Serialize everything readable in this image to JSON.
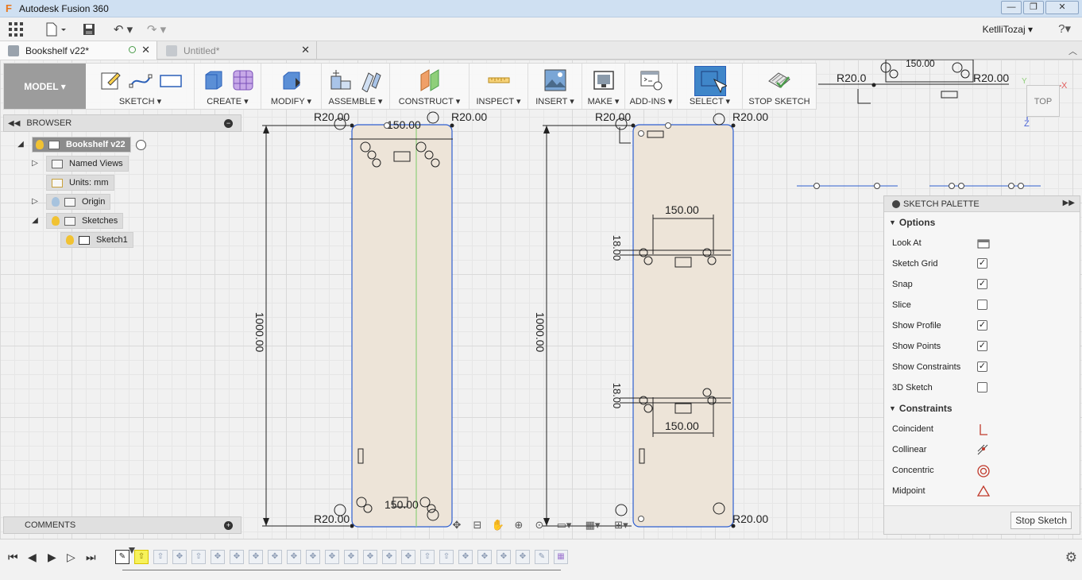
{
  "window": {
    "app_title": "Autodesk Fusion 360",
    "minimize": "—",
    "maximize": "❐",
    "close": "✕"
  },
  "menubar": {
    "user": "KetlliTozaj ▾",
    "help": "?▾"
  },
  "tabs": [
    {
      "label": "Bookshelf v22*",
      "active": true
    },
    {
      "label": "Untitled*",
      "active": false
    }
  ],
  "toolbar": {
    "mode": "MODEL ▾",
    "groups": [
      {
        "label": "SKETCH ▾"
      },
      {
        "label": "CREATE ▾"
      },
      {
        "label": "MODIFY ▾"
      },
      {
        "label": "ASSEMBLE ▾"
      },
      {
        "label": "CONSTRUCT ▾"
      },
      {
        "label": "INSPECT ▾"
      },
      {
        "label": "INSERT ▾"
      },
      {
        "label": "MAKE ▾"
      },
      {
        "label": "ADD-INS ▾"
      },
      {
        "label": "SELECT ▾"
      },
      {
        "label": "STOP SKETCH"
      }
    ]
  },
  "browser": {
    "title": "BROWSER",
    "root": "Bookshelf v22",
    "items": [
      {
        "label": "Named Views"
      },
      {
        "label": "Units: mm"
      },
      {
        "label": "Origin"
      },
      {
        "label": "Sketches"
      },
      {
        "label": "Sketch1"
      }
    ]
  },
  "comments": {
    "title": "COMMENTS"
  },
  "palette": {
    "title": "SKETCH PALETTE",
    "options_header": "Options",
    "options": [
      {
        "label": "Look At",
        "control": "button"
      },
      {
        "label": "Sketch Grid",
        "checked": true
      },
      {
        "label": "Snap",
        "checked": true
      },
      {
        "label": "Slice",
        "checked": false
      },
      {
        "label": "Show Profile",
        "checked": true
      },
      {
        "label": "Show Points",
        "checked": true
      },
      {
        "label": "Show Constraints",
        "checked": true
      },
      {
        "label": "3D Sketch",
        "checked": false
      }
    ],
    "constraints_header": "Constraints",
    "constraints": [
      {
        "label": "Coincident",
        "icon": "coincident-icon"
      },
      {
        "label": "Collinear",
        "icon": "collinear-icon"
      },
      {
        "label": "Concentric",
        "icon": "concentric-icon"
      },
      {
        "label": "Midpoint",
        "icon": "midpoint-icon"
      }
    ],
    "stop_button": "Stop Sketch"
  },
  "viewcube": {
    "face": "TOP"
  },
  "axis": {
    "x": "X",
    "z": "Z"
  },
  "dims": {
    "r20": "R20.00",
    "len150": "150.00",
    "len1000": "1000.00",
    "len18": "18.00",
    "r20_partial": "R20.0"
  },
  "colors": {
    "panel_fill": "#ede4d8",
    "sketch_blue": "#2f5fd0",
    "axis_green": "#8fcf7a"
  }
}
